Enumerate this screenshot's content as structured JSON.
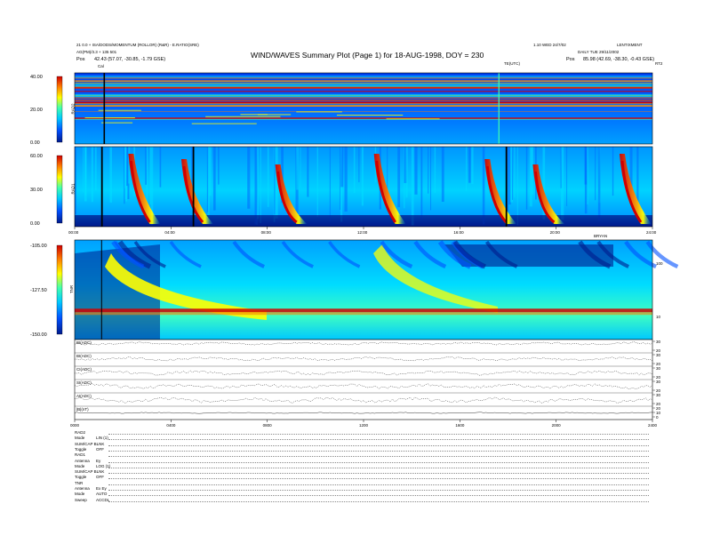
{
  "header": {
    "title": "WIND/WAVES Summary Plot (Page 1) for 18-AUG-1998, DOY = 230",
    "left_line1": "21 0.0 + ISA/DODS/MOMENTUM (ROLLOR) (R&R) - E.RATIO(SRE)",
    "left_line2": "AG(PM)/3.3 + 135 501",
    "left_line3_label": "Pos",
    "left_line3_value": "42.43 (57.07, -30.85, -1.79 GSE)",
    "right_line1": "LENTIXMENT",
    "right_line2": "DAILY TUE 29/11/2002",
    "right_line3_label": "Pos",
    "right_line3_value": "85.98 (42.69, -38.30, -0.43 GSE)",
    "mid_right_line1": "1.10 WED 24/7/02",
    "mid_right_label": "TE(UTC)",
    "corner_tag": "RT2",
    "cal_marker": "Cal"
  },
  "chart_data": [
    {
      "type": "heatmap",
      "panel": "RAD2",
      "ylabel": "RAD2",
      "ylim": [
        0,
        40
      ],
      "y_ticks": [
        "40.00",
        "20.00",
        "0.00"
      ],
      "colorscale": [
        "#001a8c",
        "#0050ff",
        "#00c8ff",
        "#40ffb0",
        "#ffff00",
        "#ff8000",
        "#d00000"
      ],
      "features": [
        {
          "x_hours": 1.2,
          "kind": "calibration line"
        },
        {
          "x_hours": 17.6,
          "kind": "data gap"
        }
      ]
    },
    {
      "type": "heatmap",
      "panel": "RAD1",
      "ylabel": "RAD1",
      "ylim": [
        0,
        60
      ],
      "y_ticks": [
        "60.00",
        "30.00",
        "0.00"
      ],
      "x_ticks": [
        "00:00",
        "04:00",
        "08:00",
        "12:00",
        "16:00",
        "20:00",
        "24:00"
      ],
      "x_tag": "BRYAN",
      "bursts_hours": [
        2.6,
        4.8,
        8.7,
        12.8,
        17.4,
        19.4,
        23.0
      ],
      "data_gaps_hours": [
        1.1,
        4.9,
        17.9
      ]
    },
    {
      "type": "heatmap",
      "panel": "TNR",
      "ylabel": "TNR",
      "ylim": [
        -150,
        -105
      ],
      "y_ticks": [
        "-105.00",
        "-127.50",
        "-150.00"
      ],
      "y2_ticks": [
        "100",
        "10"
      ],
      "plasma_line_level": -128
    },
    {
      "type": "line",
      "x_range_hours": [
        0,
        24
      ],
      "x_ticks": [
        "0000",
        "0400",
        "0800",
        "1200",
        "1600",
        "2000",
        "2400"
      ],
      "series": [
        {
          "name": "BI(ADC)",
          "scale_ticks": [
            "30",
            "20"
          ],
          "mean": 0.7,
          "amp": 0.12
        },
        {
          "name": "BI(ADC)",
          "scale_ticks": [
            "30",
            "20"
          ],
          "mean": 0.55,
          "amp": 0.15
        },
        {
          "name": "CI(ADC)",
          "scale_ticks": [
            "30",
            "20"
          ],
          "mean": 0.5,
          "amp": 0.18
        },
        {
          "name": "SI(ADC)",
          "scale_ticks": [
            "30",
            "20"
          ],
          "mean": 0.5,
          "amp": 0.2
        },
        {
          "name": "AI(ADC)",
          "scale_ticks": [
            "30",
            "20"
          ],
          "mean": 0.45,
          "amp": 0.22
        },
        {
          "name": "|B|(nT)",
          "scale_ticks": [
            "20",
            "10",
            "0"
          ],
          "mean": 0.5,
          "amp": 0.05
        }
      ]
    }
  ],
  "params": [
    {
      "label": "RAD2",
      "value": ""
    },
    {
      "label": "Mode",
      "value": "LIN (1)"
    },
    {
      "label": "SUM/CAP BLNK",
      "value": ""
    },
    {
      "label": "Toggle",
      "value": "OFF"
    },
    {
      "label": "RAD1",
      "value": ""
    },
    {
      "label": "Antenna",
      "value": "Ey"
    },
    {
      "label": "Mode",
      "value": "LOG (1)"
    },
    {
      "label": "SUM/CAP BLNK",
      "value": ""
    },
    {
      "label": "Toggle",
      "value": "OFF"
    },
    {
      "label": "TNR",
      "value": ""
    },
    {
      "label": "Antenna",
      "value": "Ex Ey"
    },
    {
      "label": "Mode",
      "value": "AUTO"
    },
    {
      "label": "Sweep",
      "value": "ACCDL"
    }
  ],
  "colors": {
    "deep_blue": "#001a8c",
    "blue": "#0050ff",
    "cyan": "#00c8ff",
    "green": "#40ffb0",
    "yellow": "#ffff00",
    "orange": "#ff8000",
    "red": "#d00000"
  }
}
